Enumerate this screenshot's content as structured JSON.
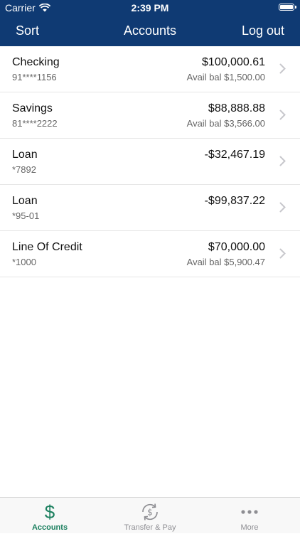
{
  "status_bar": {
    "carrier": "Carrier",
    "time": "2:39 PM"
  },
  "nav": {
    "left": "Sort",
    "title": "Accounts",
    "right": "Log out"
  },
  "accounts": [
    {
      "name": "Checking",
      "number": "91****1156",
      "balance": "$100,000.61",
      "available": "Avail bal $1,500.00"
    },
    {
      "name": "Savings",
      "number": "81****2222",
      "balance": "$88,888.88",
      "available": "Avail bal $3,566.00"
    },
    {
      "name": "Loan",
      "number": "*7892",
      "balance": "-$32,467.19",
      "available": ""
    },
    {
      "name": "Loan",
      "number": "*95-01",
      "balance": "-$99,837.22",
      "available": ""
    },
    {
      "name": "Line Of Credit",
      "number": "*1000",
      "balance": "$70,000.00",
      "available": "Avail bal $5,900.47"
    }
  ],
  "tabs": [
    {
      "label": "Accounts",
      "icon": "dollar-icon",
      "active": true
    },
    {
      "label": "Transfer & Pay",
      "icon": "transfer-pay-icon",
      "active": false
    },
    {
      "label": "More",
      "icon": "more-dots-icon",
      "active": false
    }
  ],
  "colors": {
    "header": "#0f3a73",
    "accent": "#1a7f5e",
    "inactive": "#8e8e93"
  }
}
